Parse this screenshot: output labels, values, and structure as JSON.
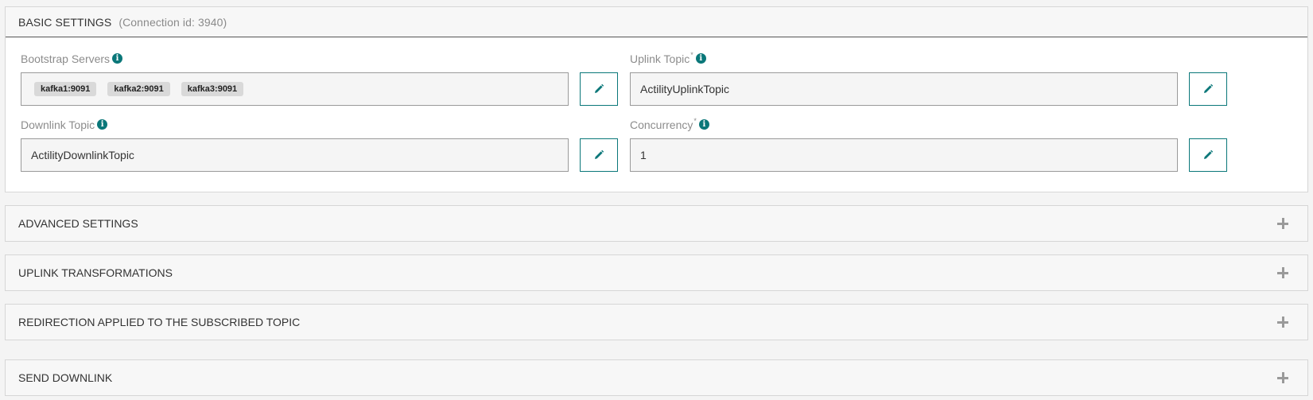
{
  "basic": {
    "title": "BASIC SETTINGS",
    "connection_id": "(Connection id: 3940)",
    "bootstrap": {
      "label": "Bootstrap Servers",
      "chips": [
        "kafka1:9091",
        "kafka2:9091",
        "kafka3:9091"
      ]
    },
    "uplink": {
      "label": "Uplink Topic",
      "required_mark": "*",
      "value": "ActilityUplinkTopic"
    },
    "downlink": {
      "label": "Downlink Topic",
      "value": "ActilityDownlinkTopic"
    },
    "concurrency": {
      "label": "Concurrency",
      "required_mark": "*",
      "value": "1"
    },
    "info_glyph": "i"
  },
  "sections": [
    {
      "title": "ADVANCED SETTINGS",
      "icon": "plus-icon"
    },
    {
      "title": "UPLINK TRANSFORMATIONS",
      "icon": "plus-icon"
    },
    {
      "title": "REDIRECTION APPLIED TO THE SUBSCRIBED TOPIC",
      "icon": "plus-icon"
    },
    {
      "title": "SEND DOWNLINK",
      "icon": "plus-icon"
    }
  ],
  "colors": {
    "accent": "#0a7779",
    "panel_bg": "#f7f7f7",
    "border": "#d6d6d6"
  }
}
